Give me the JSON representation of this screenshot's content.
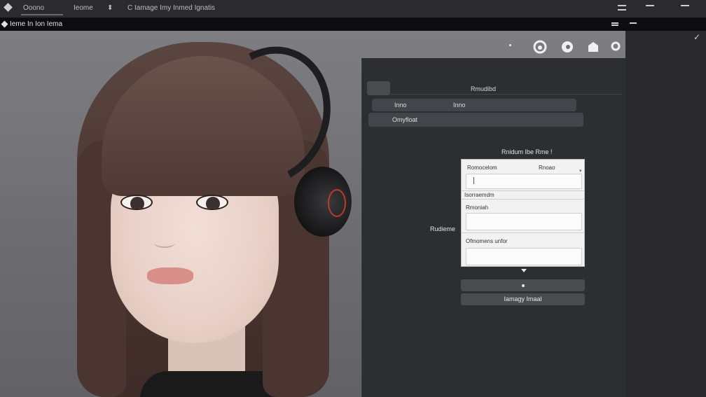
{
  "titlebar": {
    "tab_label": "Ooono",
    "menu_label": "Ieome",
    "caret": "⬍",
    "window_title": "C Iamage Imy Inmed Ignatis"
  },
  "menubar": {
    "breadcrumb": "Ieme In Ion Iema"
  },
  "panel": {
    "tab_label": "Rmudibd",
    "row1": {
      "left": "Inno",
      "right": "Inno"
    },
    "row2": {
      "label": "Omyfloat"
    },
    "section_heading": "Rnidum Ibe Rme !",
    "side_label": "Rudieme"
  },
  "form": {
    "header_left": "Romocelom",
    "header_right": "Rnoao",
    "row_label_1": "Isorraemdm",
    "row_label_2": "Rmoniah",
    "row_label_3": "Ofmomens unfor"
  },
  "buttons": {
    "apply_label": "Iamagy Imaal"
  },
  "icons": {
    "canvas_tools": [
      "spiral-icon",
      "swirl-icon",
      "bag-icon",
      "circle-icon"
    ],
    "corner": "✓"
  }
}
